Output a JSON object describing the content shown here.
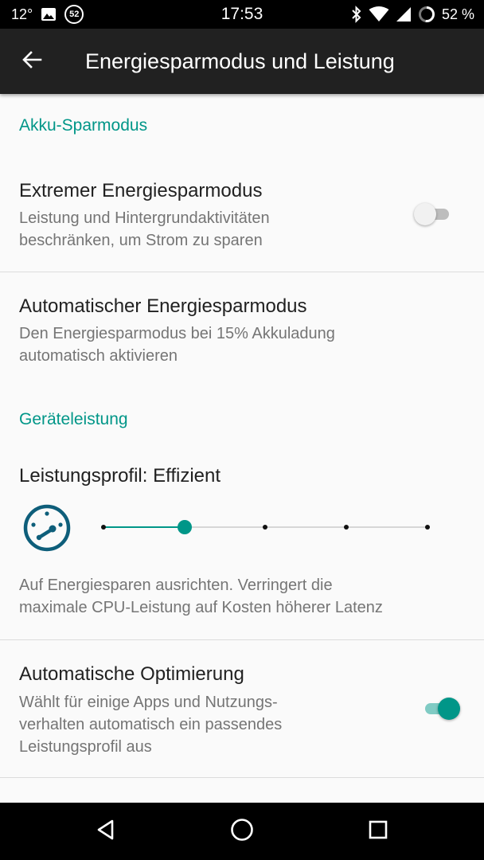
{
  "status_bar": {
    "temperature": "12°",
    "notification_badge": "52",
    "time": "17:53",
    "battery_percent": "52 %"
  },
  "app_bar": {
    "title": "Energiesparmodus und Leistung",
    "back_icon": "arrow-back-icon"
  },
  "sections": {
    "battery_saver": {
      "header": "Akku-Sparmodus",
      "extreme": {
        "title": "Extremer Energiesparmodus",
        "summary_line1": "Leistung und Hintergrundaktivitäten",
        "summary_line2": "beschränken, um Strom zu sparen",
        "enabled": false
      },
      "automatic": {
        "title": "Automatischer Energiesparmodus",
        "summary_line1": "Den Energiesparmodus bei 15% Akkuladung",
        "summary_line2": "automatisch aktivieren"
      }
    },
    "device_performance": {
      "header": "Geräteleistung",
      "profile": {
        "title": "Leistungsprofil: Effizient",
        "icon": "speedometer-icon",
        "slider_steps": 5,
        "slider_selected_index": 1,
        "description_line1": "Auf Energiesparen ausrichten. Verringert die",
        "description_line2": "maximale CPU-Leistung auf Kosten höherer Latenz"
      },
      "auto_optimization": {
        "title": "Automatische Optimierung",
        "summary_line1": "Wählt für einige Apps und Nutzungs-",
        "summary_line2": "verhalten automatisch ein passendes",
        "summary_line3": "Leistungsprofil aus",
        "enabled": true
      }
    }
  },
  "colors": {
    "accent": "#009688",
    "app_bar": "#212121",
    "background": "#fafafa"
  },
  "nav_bar": {
    "back_icon": "triangle-back-icon",
    "home_icon": "circle-home-icon",
    "recents_icon": "square-recents-icon"
  }
}
